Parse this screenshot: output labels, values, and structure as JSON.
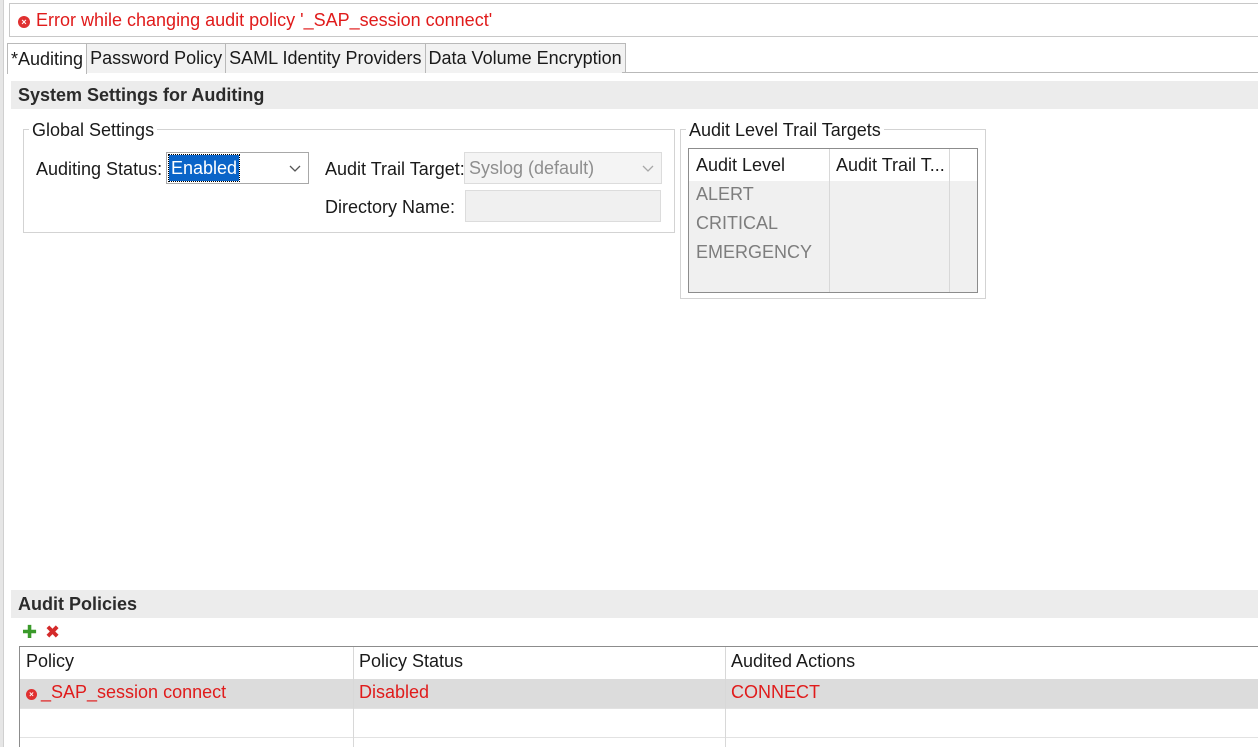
{
  "error": {
    "message": "Error while changing audit policy '_SAP_session connect'",
    "icon": "error-icon"
  },
  "tabs": [
    {
      "label": "*Auditing",
      "active": true
    },
    {
      "label": "Password Policy",
      "active": false
    },
    {
      "label": "SAML Identity Providers",
      "active": false
    },
    {
      "label": "Data Volume Encryption",
      "active": false
    }
  ],
  "system_settings": {
    "title": "System Settings for Auditing"
  },
  "global_settings": {
    "title": "Global Settings",
    "auditing_status_label": "Auditing Status:",
    "auditing_status_value": "Enabled",
    "audit_trail_target_label": "Audit Trail Target:",
    "audit_trail_target_value": "Syslog (default)",
    "directory_name_label": "Directory Name:",
    "directory_name_value": ""
  },
  "audit_level_targets": {
    "title": "Audit Level Trail Targets",
    "columns": [
      "Audit Level",
      "Audit Trail T..."
    ],
    "rows": [
      [
        "ALERT",
        ""
      ],
      [
        "CRITICAL",
        ""
      ],
      [
        "EMERGENCY",
        ""
      ]
    ]
  },
  "audit_policies": {
    "title": "Audit Policies",
    "toolbar": {
      "add_icon": "add-icon",
      "delete_icon": "delete-icon"
    },
    "columns": [
      "Policy",
      "Policy Status",
      "Audited Actions"
    ],
    "rows": [
      {
        "policy": "_SAP_session connect",
        "status": "Disabled",
        "actions": "CONNECT",
        "error": true
      }
    ]
  },
  "colors": {
    "error": "#e01b1b",
    "selection": "#0a64c8",
    "header_bg": "#ececec"
  }
}
